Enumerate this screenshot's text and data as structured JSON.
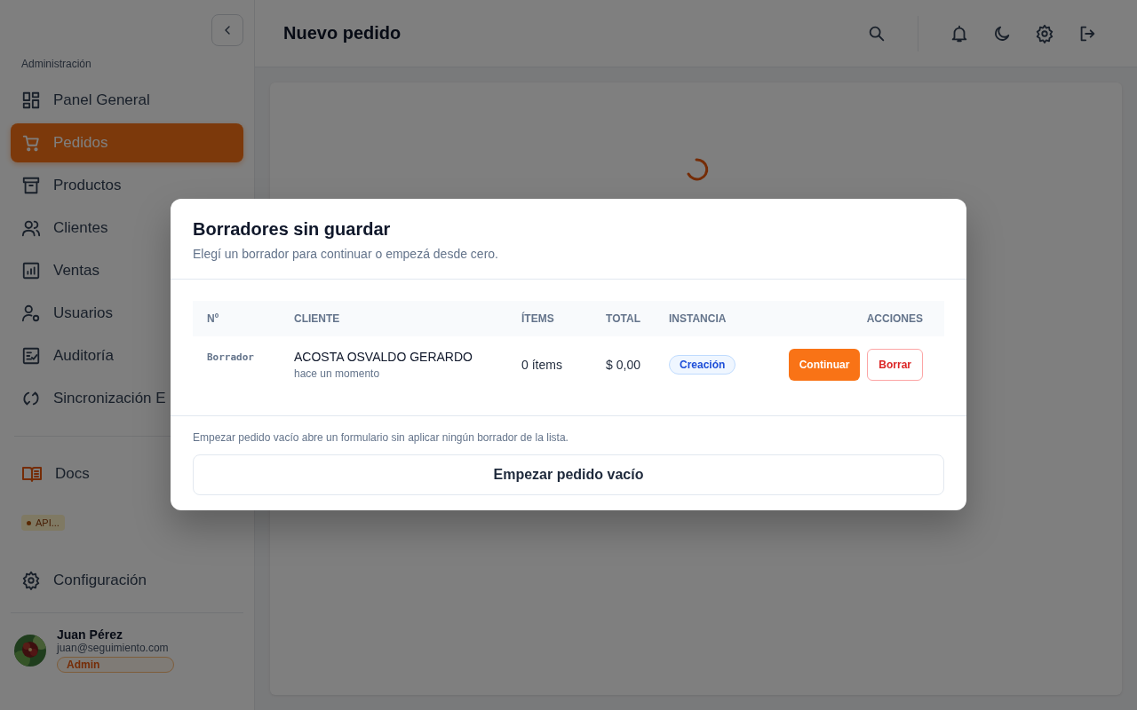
{
  "sidebar": {
    "section_label": "Administración",
    "items": [
      {
        "label": "Panel General",
        "selected": false
      },
      {
        "label": "Pedidos",
        "selected": true
      },
      {
        "label": "Productos",
        "selected": false
      },
      {
        "label": "Clientes",
        "selected": false
      },
      {
        "label": "Ventas",
        "selected": false
      },
      {
        "label": "Usuarios",
        "selected": false
      },
      {
        "label": "Auditoría",
        "selected": false
      },
      {
        "label": "Sincronización E",
        "selected": false
      }
    ],
    "docs": {
      "label": "Docs"
    },
    "api_badge": {
      "label": "API..."
    },
    "settings": {
      "label": "Configuración"
    },
    "user": {
      "name": "Juan Pérez",
      "email": "juan@seguimiento.com",
      "role": "Admin"
    }
  },
  "header": {
    "title": "Nuevo pedido"
  },
  "modal": {
    "title": "Borradores sin guardar",
    "subtitle": "Elegí un borrador para continuar o empezá desde cero.",
    "columns": [
      "Nº",
      "CLIENTE",
      "ÍTEMS",
      "TOTAL",
      "INSTANCIA",
      "ACCIONES"
    ],
    "rows": [
      {
        "number": "Borrador",
        "client": "ACOSTA OSVALDO GERARDO",
        "time": "hace un momento",
        "items": "0 ítems",
        "total": "$ 0,00",
        "instance": "Creación",
        "actions": [
          "Continuar",
          "Borrar"
        ]
      }
    ],
    "footer_note": "Empezar pedido vacío abre un formulario sin aplicar ningún borrador de la lista.",
    "empty_button": "Empezar pedido vacío"
  }
}
